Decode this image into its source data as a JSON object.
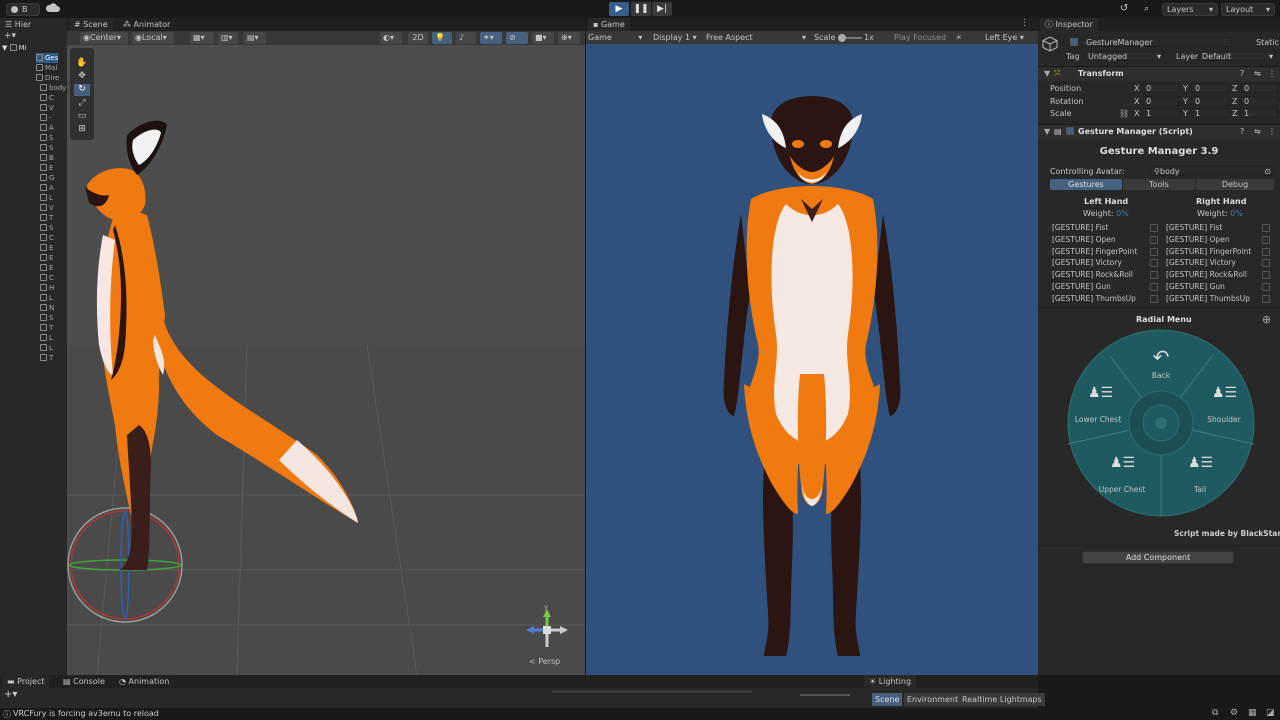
{
  "topbar": {
    "account_label": "B",
    "layers_label": "Layers",
    "layout_label": "Layout"
  },
  "hierarchy": {
    "tab_label": "Hier",
    "root_label": "Mi",
    "rows": [
      "Ges",
      "Mai",
      "Dire",
      "body",
      "C",
      "V",
      "-",
      "A",
      "S",
      "S",
      "B",
      "E",
      "G",
      "A",
      "L",
      "V",
      "T",
      "S",
      "C",
      "E",
      "E",
      "E",
      "C",
      "H",
      "L",
      "N",
      "S",
      "T",
      "L",
      "L",
      "T"
    ]
  },
  "scene": {
    "tab_scene": "Scene",
    "tab_animator": "Animator",
    "pivot_label": "Center",
    "space_label": "Local",
    "btn_2d": "2D",
    "persp_label": "< Persp",
    "gizmo_y": "y"
  },
  "game": {
    "tab_label": "Game",
    "mode_label": "Game",
    "display_label": "Display 1",
    "aspect_label": "Free Aspect",
    "scale_label": "Scale",
    "scale_value": "1x",
    "play_focused": "Play Focused",
    "eye_label": "Left Eye"
  },
  "inspector": {
    "tab_label": "Inspector",
    "object_name": "GestureManager",
    "static_label": "Static",
    "tag_label": "Tag",
    "tag_value": "Untagged",
    "layer_label": "Layer",
    "layer_value": "Default",
    "transform": {
      "title": "Transform",
      "position_label": "Position",
      "rotation_label": "Rotation",
      "scale_label": "Scale",
      "x": "X",
      "y": "Y",
      "z": "Z",
      "pos": [
        "0",
        "0",
        "0"
      ],
      "rot": [
        "0",
        "0",
        "0"
      ],
      "scl": [
        "1",
        "1",
        "1"
      ]
    },
    "script": {
      "title": "Gesture Manager (Script)",
      "heading": "Gesture Manager 3.9",
      "avatar_label": "Controlling Avatar:",
      "avatar_value": "body",
      "tabs": [
        "Gestures",
        "Tools",
        "Debug"
      ],
      "left_hand": "Left Hand",
      "right_hand": "Right Hand",
      "weight_label": "Weight:",
      "weight_value": "0%",
      "gestures": [
        "[GESTURE] Fist",
        "[GESTURE] Open",
        "[GESTURE] FingerPoint",
        "[GESTURE] Victory",
        "[GESTURE] Rock&Roll",
        "[GESTURE] Gun",
        "[GESTURE] ThumbsUp"
      ],
      "radial_title": "Radial Menu",
      "radial_items": {
        "back": "Back",
        "lower_chest": "Lower Chest",
        "shoulder": "Shoulder",
        "upper_chest": "Upper Chest",
        "tail": "Tail"
      },
      "credit": "Script made by BlackStartx"
    },
    "add_component": "Add Component"
  },
  "bottom": {
    "tabs": [
      "Project",
      "Console",
      "Animation"
    ],
    "lighting_tab": "Lighting",
    "lighting_subtabs": [
      "Scene",
      "Environment",
      "Realtime Lightmaps"
    ],
    "status_text": "VRCFury is forcing av3emu to reload"
  },
  "colors": {
    "accent": "#4a7dbd",
    "game_bg": "#30507e",
    "scene_bg": "#474747",
    "teal": "#1e5a5f"
  }
}
